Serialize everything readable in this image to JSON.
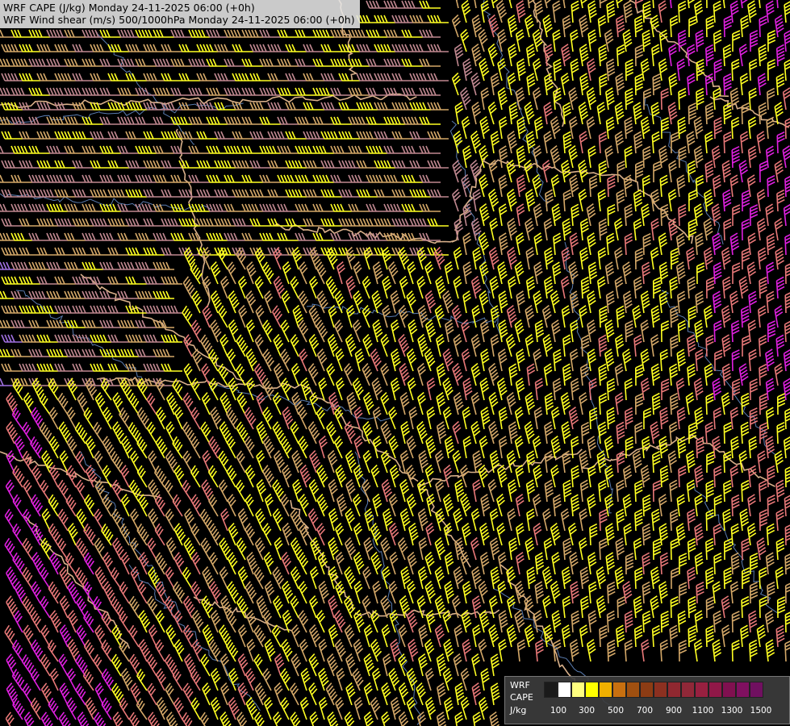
{
  "header": {
    "line1": "WRF CAPE (J/kg) Monday 24-11-2025 06:00 (+0h)",
    "line2": "WRF Wind shear (m/s) 500/1000hPa Monday 24-11-2025 06:00 (+0h)"
  },
  "legend": {
    "title_lines": [
      "WRF",
      "CAPE",
      "J/kg"
    ],
    "ticks": [
      "100",
      "300",
      "500",
      "700",
      "900",
      "1100",
      "1300",
      "1500"
    ],
    "colors": [
      "#1a1a1a",
      "#ffffff",
      "#ffff80",
      "#ffff00",
      "#f0b000",
      "#c87010",
      "#a05010",
      "#8c3c14",
      "#8c3020",
      "#902830",
      "#902838",
      "#982040",
      "#901848",
      "#801050",
      "#801060",
      "#701060"
    ]
  },
  "map": {
    "background": "#000000",
    "barb_colors": {
      "yellow": "#ffff22",
      "tan": "#d4a868",
      "pink": "#e87878",
      "magenta": "#e020e0",
      "violet": "#a070e0",
      "mauve": "#c08890"
    }
  }
}
